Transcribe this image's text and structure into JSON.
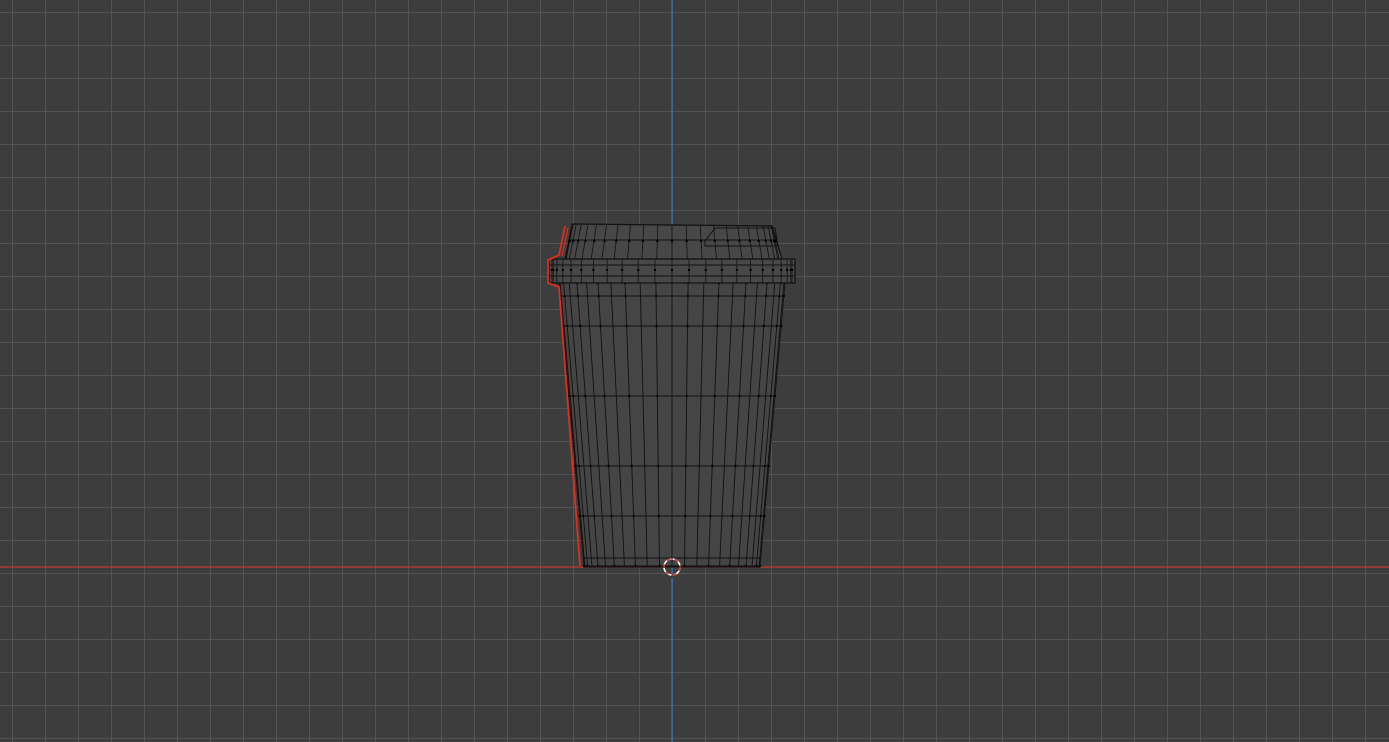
{
  "viewport": {
    "view": "front-orthographic",
    "background_color": "#3d3d3d",
    "grid_color": "#545454",
    "grid_visible": true
  },
  "axes": {
    "x_axis_color": "#c4392f",
    "z_axis_color": "#2f74c0"
  },
  "object": {
    "shape": "takeaway-cup",
    "shading": "wireframe",
    "wire_color": "#111111",
    "selection_outline_color": "#e02d1c"
  },
  "cursor_3d": {
    "name": "3d-cursor",
    "ring_colors": [
      "#e04040",
      "#ffffff"
    ]
  }
}
